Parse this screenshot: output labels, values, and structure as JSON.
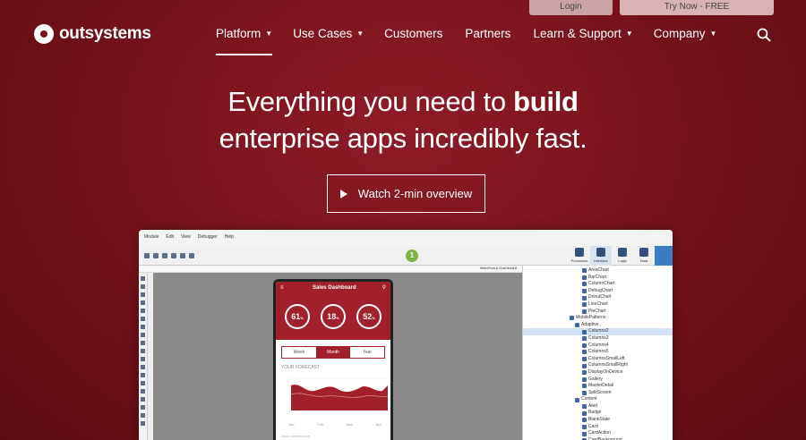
{
  "topbar": {
    "login": "Login",
    "try": "Try Now - FREE"
  },
  "brand": {
    "name": "outsystems"
  },
  "nav": [
    {
      "label": "Platform",
      "has_menu": true,
      "active": true
    },
    {
      "label": "Use Cases",
      "has_menu": true
    },
    {
      "label": "Customers",
      "has_menu": false
    },
    {
      "label": "Partners",
      "has_menu": false
    },
    {
      "label": "Learn & Support",
      "has_menu": true
    },
    {
      "label": "Company",
      "has_menu": true
    }
  ],
  "hero": {
    "line1_pre": "Everything you need to ",
    "line1_bold": "build",
    "line2": "enterprise apps incredibly fast."
  },
  "cta": {
    "label": "Watch 2-min overview"
  },
  "studio": {
    "menu": [
      "Module",
      "Edit",
      "View",
      "Debugger",
      "Help"
    ],
    "step_badge": "1",
    "breadcrumb": "MainFlow ▸ Dashboard",
    "tabs": [
      "Processes",
      "Interface",
      "Logic",
      "Data"
    ],
    "tree": [
      "AreaChart",
      "BarChart",
      "ColumnChart",
      "DebugChart",
      "DonutChart",
      "LineChart",
      "PieChart",
      "MobilePatterns",
      "Adaptive",
      "Columns2",
      "Columns3",
      "Columns4",
      "Columns5",
      "ColumnsSmallLeft",
      "ColumnsSmallRight",
      "DisplayOnDevice",
      "Gallery",
      "MasterDetail",
      "SplitScreen",
      "Content",
      "Alert",
      "Badge",
      "BlankSlate",
      "Card",
      "CardAction",
      "CardBackground"
    ],
    "selected_node": "Columns2"
  },
  "phone": {
    "title": "Sales Dashboard",
    "kpis": [
      {
        "value": "61",
        "unit": "%"
      },
      {
        "value": "18",
        "unit": "%"
      },
      {
        "value": "52",
        "unit": "%"
      }
    ],
    "segments": [
      "Week",
      "Month",
      "Year"
    ],
    "active_segment": "Month",
    "forecast_label": "YOUR FORECAST",
    "axis": [
      "Jan",
      "Feb",
      "Mar",
      "Apr"
    ],
    "footer": "Drop content here"
  },
  "colors": {
    "accent": "#a1202b",
    "background": "#7a131c",
    "badge": "#7cb342"
  }
}
